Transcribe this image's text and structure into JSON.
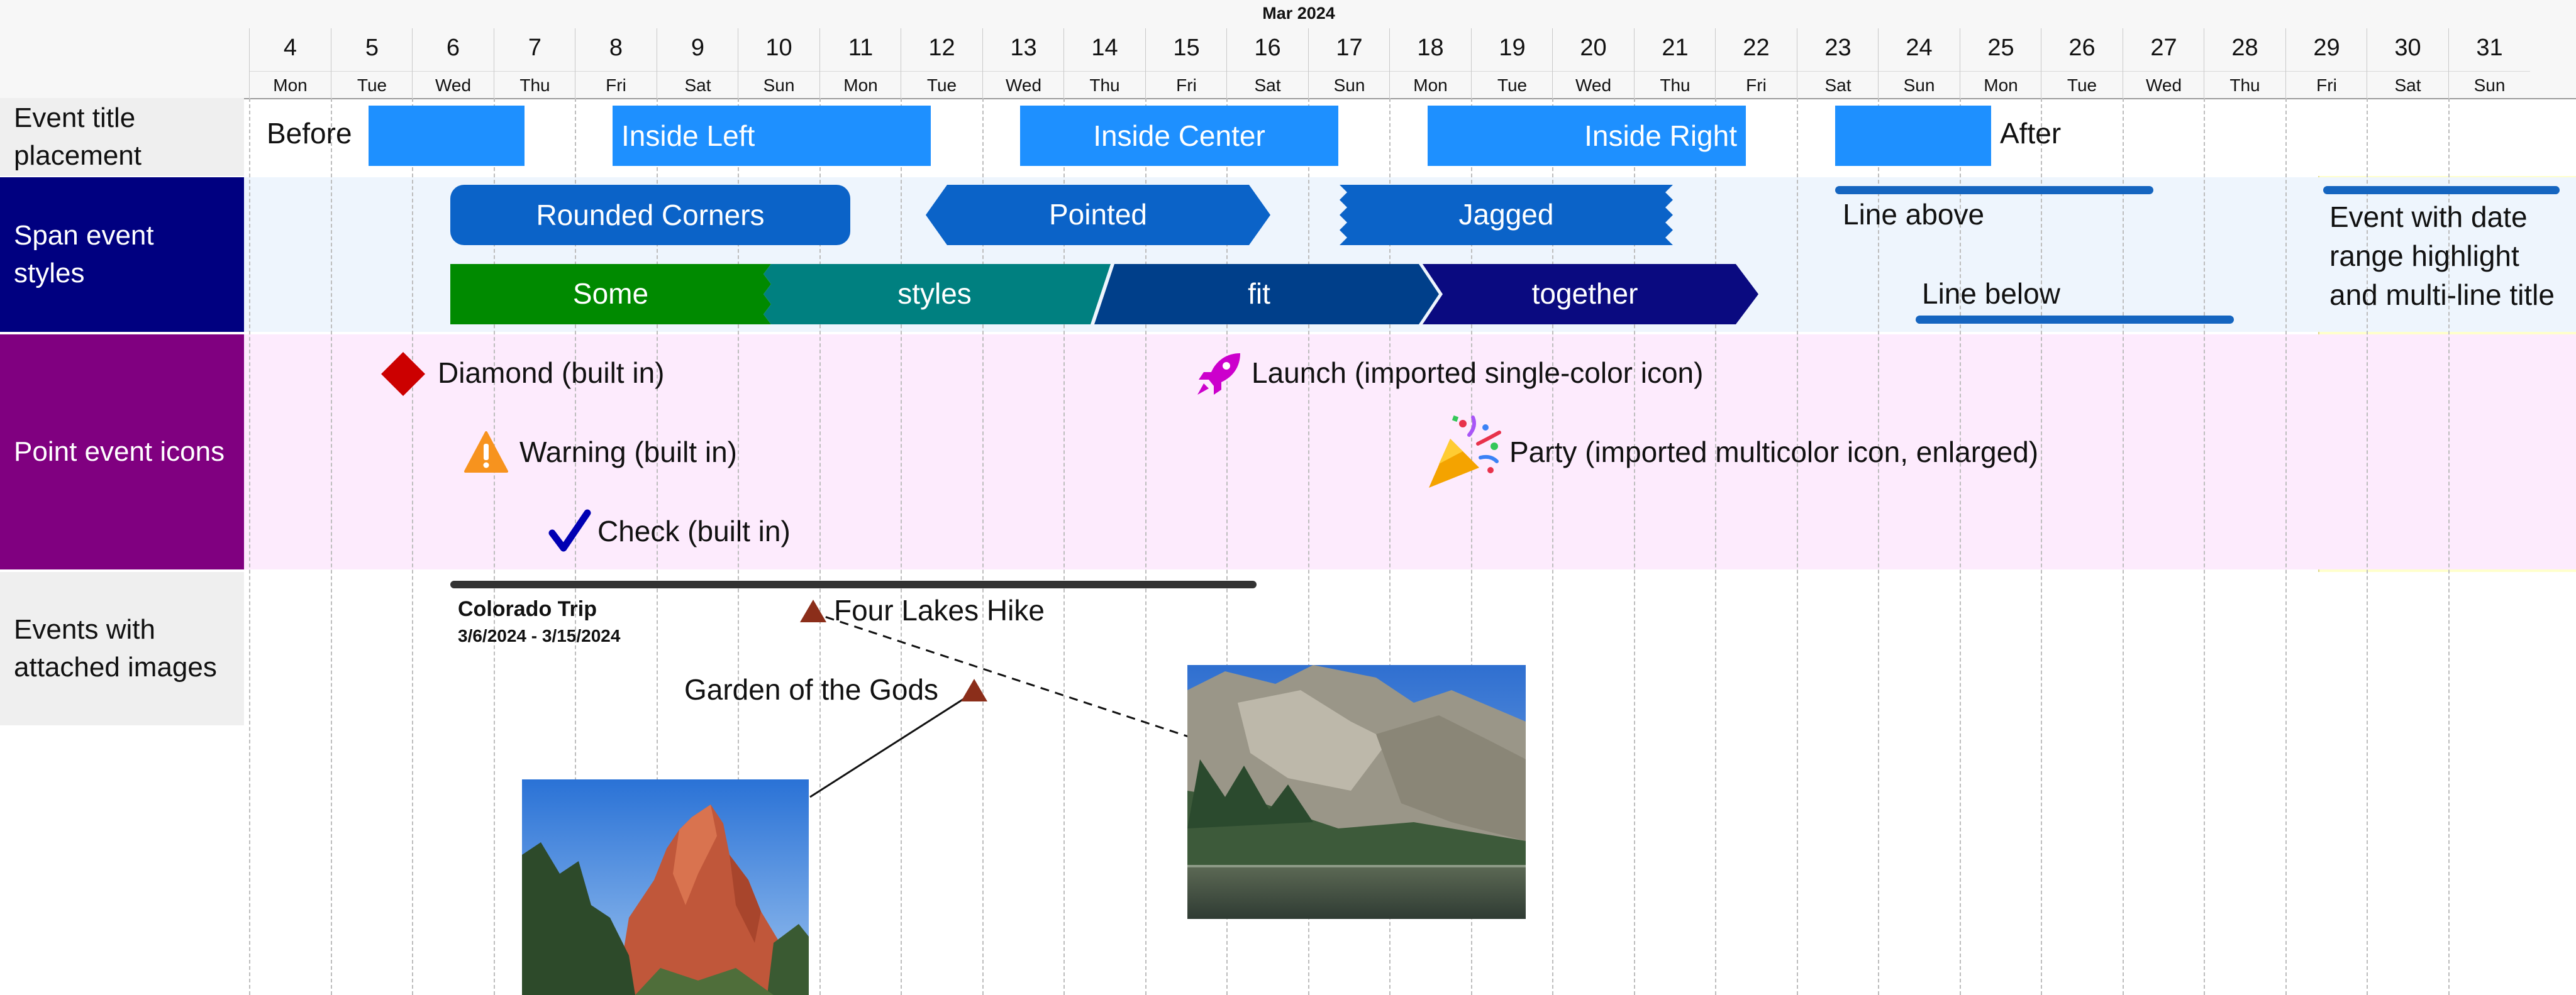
{
  "month_label": "Mar 2024",
  "days": [
    {
      "num": "4",
      "name": "Mon"
    },
    {
      "num": "5",
      "name": "Tue"
    },
    {
      "num": "6",
      "name": "Wed"
    },
    {
      "num": "7",
      "name": "Thu"
    },
    {
      "num": "8",
      "name": "Fri"
    },
    {
      "num": "9",
      "name": "Sat"
    },
    {
      "num": "10",
      "name": "Sun"
    },
    {
      "num": "11",
      "name": "Mon"
    },
    {
      "num": "12",
      "name": "Tue"
    },
    {
      "num": "13",
      "name": "Wed"
    },
    {
      "num": "14",
      "name": "Thu"
    },
    {
      "num": "15",
      "name": "Fri"
    },
    {
      "num": "16",
      "name": "Sat"
    },
    {
      "num": "17",
      "name": "Sun"
    },
    {
      "num": "18",
      "name": "Mon"
    },
    {
      "num": "19",
      "name": "Tue"
    },
    {
      "num": "20",
      "name": "Wed"
    },
    {
      "num": "21",
      "name": "Thu"
    },
    {
      "num": "22",
      "name": "Fri"
    },
    {
      "num": "23",
      "name": "Sat"
    },
    {
      "num": "24",
      "name": "Sun"
    },
    {
      "num": "25",
      "name": "Mon"
    },
    {
      "num": "26",
      "name": "Tue"
    },
    {
      "num": "27",
      "name": "Wed"
    },
    {
      "num": "28",
      "name": "Thu"
    },
    {
      "num": "29",
      "name": "Fri"
    },
    {
      "num": "30",
      "name": "Sat"
    },
    {
      "num": "31",
      "name": "Sun"
    }
  ],
  "rows": [
    {
      "label": "Event title placement",
      "band_color": "#ffffff",
      "label_bg": "#efefef",
      "label_color": "#111111"
    },
    {
      "label": "Span event styles",
      "band_color": "#eef5fd",
      "label_bg": "#000080",
      "label_color": "#ffffff"
    },
    {
      "label": "Point event icons",
      "band_color": "#fdebfd",
      "label_bg": "#800080",
      "label_color": "#ffffff"
    },
    {
      "label": "Events with attached images",
      "band_color": "#ffffff",
      "label_bg": "#efefef",
      "label_color": "#111111"
    }
  ],
  "title_placement": {
    "before": "Before",
    "inside_left": "Inside Left",
    "inside_center": "Inside Center",
    "inside_right": "Inside Right",
    "after": "After",
    "bar_color": "#1e90ff"
  },
  "span_styles": {
    "rounded": "Rounded Corners",
    "pointed": "Pointed",
    "jagged": "Jagged",
    "line_above": "Line above",
    "line_below": "Line below",
    "some": "Some",
    "styles": "styles",
    "fit": "fit",
    "together": "together",
    "colors": {
      "blue": "#0b63c8",
      "green": "#008a00",
      "teal": "#008080",
      "navy": "#003f8a",
      "indigo": "#0a0a80",
      "line": "#1565c0"
    }
  },
  "highlight": {
    "title": "Event with date range highlight and multi-line title",
    "color": "#ffffcc"
  },
  "points": {
    "diamond": "Diamond (built in)",
    "warning": "Warning (built in)",
    "check": "Check (built in)",
    "launch": "Launch (imported single-color icon)",
    "party": "Party (imported multicolor icon, enlarged)",
    "icons": [
      "diamond-icon",
      "warning-icon",
      "check-icon",
      "rocket-icon",
      "party-popper-icon"
    ],
    "colors": {
      "diamond": "#cc0000",
      "warning": "#f7931e",
      "check": "#0000b3",
      "launch": "#cc00cc"
    }
  },
  "images_row": {
    "trip_title": "Colorado Trip",
    "trip_dates": "3/6/2024 - 3/15/2024",
    "hike": "Four Lakes Hike",
    "garden": "Garden of the Gods",
    "marker_color": "#8b2e1a"
  }
}
